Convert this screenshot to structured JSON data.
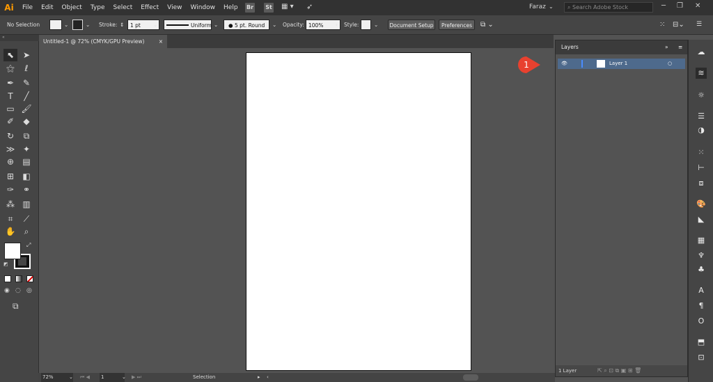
{
  "app": {
    "logo": "Ai"
  },
  "menu": [
    "File",
    "Edit",
    "Object",
    "Type",
    "Select",
    "Effect",
    "View",
    "Window",
    "Help"
  ],
  "menu_icons": {
    "bridge": "Br",
    "stock": "St"
  },
  "user": "Faraz",
  "search": {
    "placeholder": "Search Adobe Stock"
  },
  "control": {
    "selection": "No Selection",
    "stroke_label": "Stroke:",
    "stroke_value": "1 pt",
    "profile": "Uniform",
    "brush": "5 pt. Round",
    "opacity_label": "Opacity:",
    "opacity_value": "100%",
    "style_label": "Style:",
    "doc_setup": "Document Setup",
    "preferences": "Preferences"
  },
  "document": {
    "tab": "Untitled-1 @ 72% (CMYK/GPU Preview)",
    "close": "×"
  },
  "status": {
    "zoom": "72%",
    "page": "1",
    "tool": "Selection"
  },
  "layers": {
    "title": "Layers",
    "rows": [
      {
        "name": "Layer 1"
      }
    ],
    "count": "1 Layer"
  },
  "callout": {
    "number": "1",
    "color": "#e8412f"
  },
  "colors": {
    "selection_blue": "#4e6a8c",
    "accent": "#ff9a00"
  }
}
